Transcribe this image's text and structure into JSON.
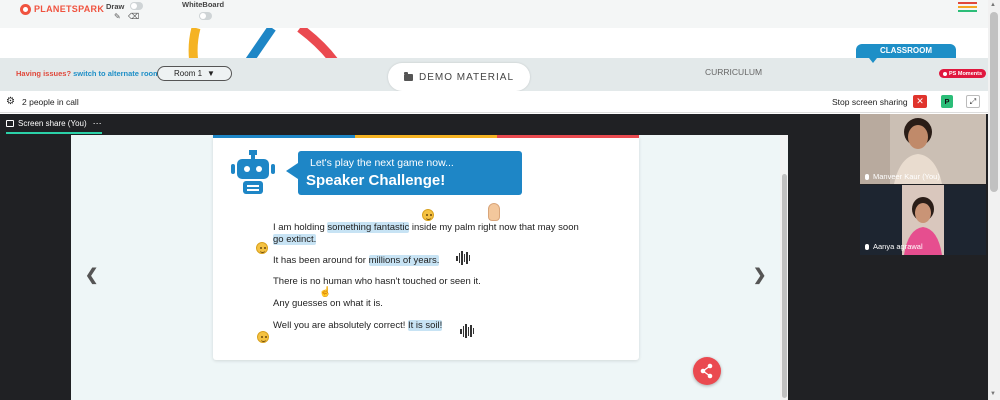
{
  "header": {
    "logo_text": "PLANETSPARK",
    "draw_label": "Draw",
    "whiteboard_label": "WhiteBoard",
    "pencil_icon": "pencil-icon",
    "eraser_icon": "eraser-icon",
    "menu_icon": "hamburger-icon",
    "menu_colors": [
      "#e0483b",
      "#f5a623",
      "#2bbd78"
    ]
  },
  "nav": {
    "issues_text": "Having issues?",
    "alternate_room_link": "switch to alternate room",
    "room_select_value": "Room 1",
    "demo_material_label": "DEMO MATERIAL",
    "curriculum_label": "CURRICULUM",
    "classroom_label": "CLASSROOM",
    "ps_moments_label": "PS Moments"
  },
  "call": {
    "people_count_text": "2 people in call",
    "stop_sharing_label": "Stop screen sharing",
    "close_label": "✕",
    "p_label": "P",
    "expand_label": "⤢",
    "share_tab_label": "Screen share (You)",
    "share_tab_more": "⋯"
  },
  "slide": {
    "banner_line1": "Let's play the next game now...",
    "banner_title": "Speaker Challenge!",
    "line1_a": "I am holding ",
    "line1_hl": "something fantastic",
    "line1_b": " inside my palm right now that may soon",
    "line1_c_hl": "go extinct.",
    "line2_a": "It has been around for ",
    "line2_hl": "millions of years.",
    "line3": "There is no human who hasn't touched or seen it.",
    "line4": "Any guesses on what it is.",
    "line5_a": "Well you are absolutely correct! ",
    "line5_hl": "It is soil!"
  },
  "participants": [
    {
      "name": "Manveer Kaur (You)"
    },
    {
      "name": "Aanya agrawal"
    }
  ],
  "colors": {
    "brand_red": "#f0533f",
    "accent_blue": "#1e8fc7",
    "stripe": [
      "#1e86c6",
      "#f5b323",
      "#ea4a50"
    ]
  }
}
